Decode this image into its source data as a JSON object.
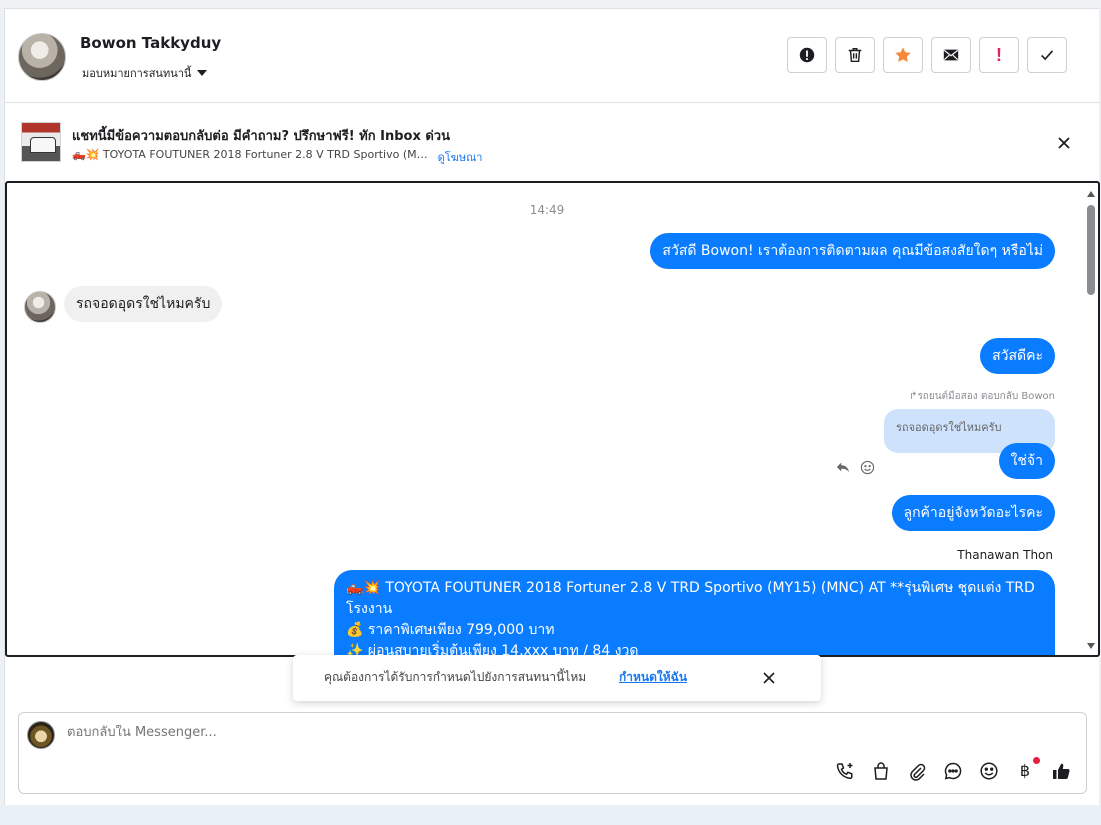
{
  "header": {
    "contact_name": "Bowon Takkyduy",
    "assign_label": "มอบหมายการสนทนานี้",
    "actions": [
      {
        "name": "report-icon",
        "label": ""
      },
      {
        "name": "trash-icon",
        "label": ""
      },
      {
        "name": "star-icon",
        "label": ""
      },
      {
        "name": "mail-icon",
        "label": ""
      },
      {
        "name": "exclamation-icon",
        "label": "!"
      },
      {
        "name": "check-icon",
        "label": ""
      }
    ]
  },
  "banner": {
    "title": "แชทนี้มีข้อความตอบกลับต่อ มีคำถาม? ปรึกษาฟรี! ทัก Inbox ด่วน",
    "subtitle": "🛻💥 TOYOTA FOUTUNER 2018 Fortuner 2.8 V TRD Sportivo (M…",
    "link": "ดูโฆษณา"
  },
  "chat": {
    "timestamp": "14:49",
    "messages": [
      {
        "dir": "out",
        "text": "สวัสดี Bowon! เราต้องการติดตามผล คุณมีข้อสงสัยใดๆ หรือไม่"
      },
      {
        "dir": "in",
        "text": "รถจอดอุดรใช่ไหมครับ"
      },
      {
        "dir": "out",
        "text": "สวัสดีคะ"
      },
      {
        "dir": "out",
        "text": "ใช่จ้า"
      },
      {
        "dir": "out",
        "text": "ลูกค้าอยู่จังหวัดอะไรคะ"
      }
    ],
    "reply_note": "รถยนต์มือสอง ตอบกลับ Bowon",
    "quoted_text": "รถจอดอุดรใช่ไหมครับ",
    "sender_name": "Thanawan Thon",
    "ad_message": {
      "line1": "🛻💥 TOYOTA FOUTUNER 2018 Fortuner 2.8 V TRD Sportivo (MY15) (MNC) AT **รุ่นพิเศษ ชุดแต่ง TRD โรงงาน",
      "line2": "💰 ราคาพิเศษเพียง 799,000 บาท",
      "line3": "✨ ผ่อนสบายเริ่มต้นเพียง 14,xxx บาท / 84 งวด"
    }
  },
  "toast": {
    "text": "คุณต้องการได้รับการกำหนดไปยังการสนทนานี้ไหม",
    "link": "กำหนดให้ฉัน"
  },
  "composer": {
    "placeholder": "ตอบกลับใน Messenger...",
    "baht_symbol": "฿"
  },
  "colors": {
    "accent": "#0a7cff",
    "star": "#f5883a",
    "danger": "#e0245e"
  }
}
